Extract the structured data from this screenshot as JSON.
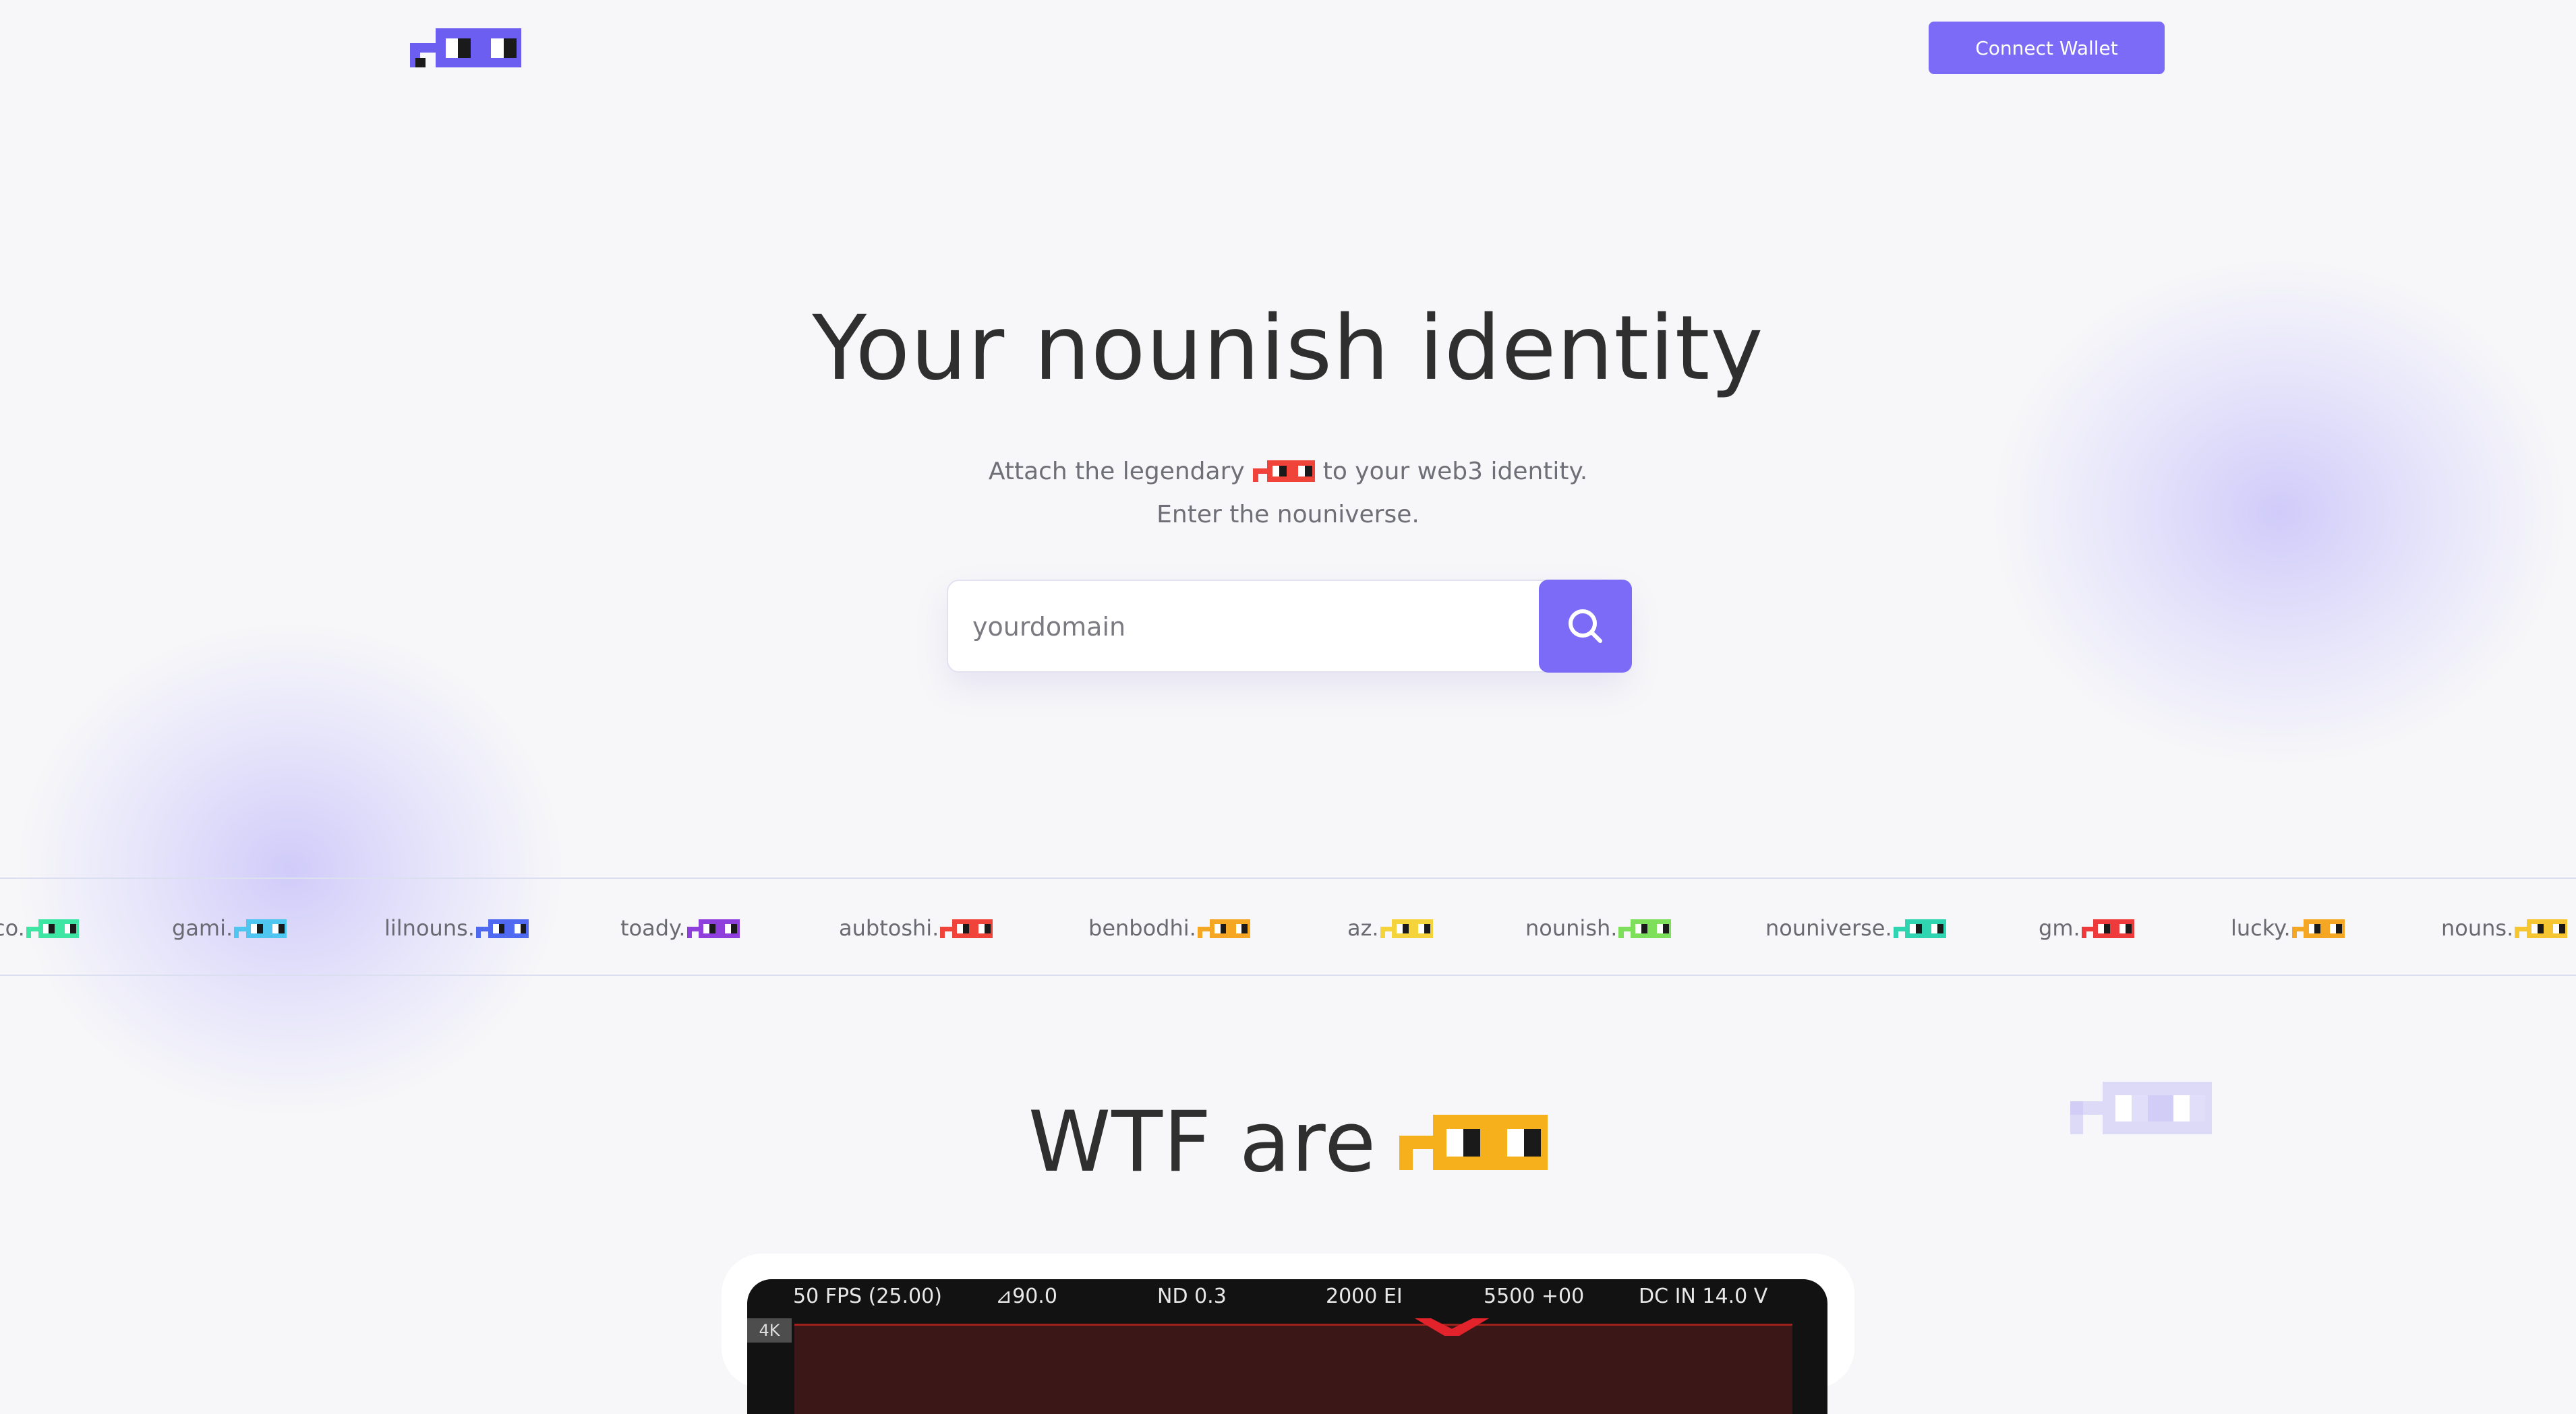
{
  "header": {
    "logo_name": "nounish-glasses-logo",
    "connect_label": "Connect Wallet",
    "brand_color": "#7b6bf7"
  },
  "hero": {
    "title": "Your nounish identity",
    "subtitle_before": "Attach the legendary",
    "subtitle_after": "to your web3 identity.",
    "subtitle_line2": "Enter the nouniverse."
  },
  "search": {
    "placeholder": "yourdomain",
    "value": "",
    "icon": "search-icon"
  },
  "ticker": {
    "items": [
      {
        "label": "co.",
        "color": "#3ee6a4"
      },
      {
        "label": "gami.",
        "color": "#4ec6ef"
      },
      {
        "label": "lilnouns.",
        "color": "#4f6af0"
      },
      {
        "label": "toady.",
        "color": "#8e3fdc"
      },
      {
        "label": "aubtoshi.",
        "color": "#f0443a"
      },
      {
        "label": "benbodhi.",
        "color": "#f5a623"
      },
      {
        "label": "az.",
        "color": "#f5d33a"
      },
      {
        "label": "nounish.",
        "color": "#7ee05a"
      },
      {
        "label": "nouniverse.",
        "color": "#2fd5b0"
      },
      {
        "label": "gm.",
        "color": "#ee3a3a"
      },
      {
        "label": "lucky.",
        "color": "#f5a623"
      },
      {
        "label": "nouns.",
        "color": "#f5c631"
      }
    ]
  },
  "wtf": {
    "title": "WTF are",
    "glasses_color": "#f5b01c"
  },
  "video": {
    "fps": "50 FPS (25.00)",
    "shutter": "⊿90.0",
    "nd": "ND 0.3",
    "ei": "2000 EI",
    "wb": "5500 +00",
    "power": "DC IN 14.0 V",
    "badge": "4K"
  }
}
